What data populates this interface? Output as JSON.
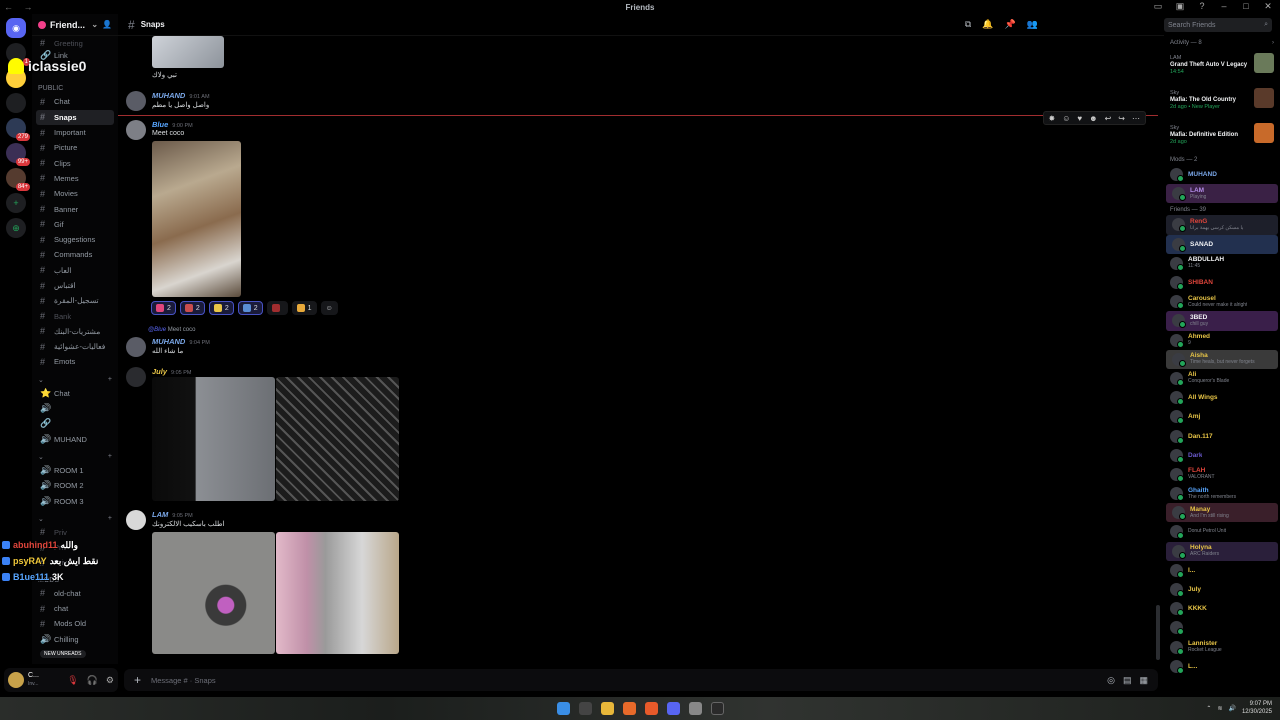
{
  "window": {
    "title": "Friends",
    "controls": [
      "pin",
      "minimize",
      "help",
      "minimize",
      "maximize",
      "close"
    ]
  },
  "rail": {
    "badges": [
      "1",
      "279",
      "99+",
      "84+"
    ]
  },
  "server": {
    "name": "Friend...",
    "overlay_username": "iclassie0"
  },
  "sidebar": {
    "top_items": [
      "Greeting",
      "Link"
    ],
    "public_label": "PUBLIC",
    "channels": [
      {
        "name": "Chat",
        "state": "normal"
      },
      {
        "name": "Snaps",
        "state": "active"
      },
      {
        "name": "Important",
        "state": "normal"
      },
      {
        "name": "Picture",
        "state": "normal"
      },
      {
        "name": "Clips",
        "state": "normal"
      },
      {
        "name": "Memes",
        "state": "normal"
      },
      {
        "name": "Movies",
        "state": "normal"
      },
      {
        "name": "Banner",
        "state": "normal"
      },
      {
        "name": "Gif",
        "state": "normal"
      },
      {
        "name": "Suggestions",
        "state": "normal"
      },
      {
        "name": "Commands",
        "state": "normal"
      },
      {
        "name": "العاب",
        "state": "normal"
      },
      {
        "name": "اقتباس",
        "state": "normal"
      },
      {
        "name": "تسجيل-المقرة",
        "state": "normal"
      },
      {
        "name": "Bank",
        "state": "muted"
      },
      {
        "name": "مشتريات-البنك",
        "state": "normal"
      },
      {
        "name": "فعاليات-عشوائية",
        "state": "normal"
      },
      {
        "name": "Emots",
        "state": "normal"
      }
    ],
    "voice_category": [
      {
        "name": "Chat",
        "icon": "star"
      },
      {
        "name": "",
        "icon": "speaker"
      },
      {
        "name": "",
        "icon": "link"
      },
      {
        "name": "MUHAND",
        "icon": "speaker"
      }
    ],
    "rooms": [
      "ROOM 1",
      "ROOM 2",
      "ROOM 3"
    ],
    "private": [
      "Priv",
      "Priv",
      "Priv"
    ],
    "mods_label": "Mods",
    "mods_channels": [
      "old-chat",
      "chat",
      "Mods Old",
      "Chilling"
    ],
    "new_unreads": "NEW UNREADS"
  },
  "chat_overlay": [
    {
      "user": "abuhind11",
      "text": "والله",
      "color": "#e0453b"
    },
    {
      "user": "psyRAY",
      "text": "نقط ايش بعد",
      "color": "#f0c83a"
    },
    {
      "user": "B1ue111",
      "text": "3K",
      "color": "#58a6ff"
    }
  ],
  "user_panel": {
    "name": "C...",
    "status": "Inv..."
  },
  "channel_header": {
    "name": "Snaps",
    "search_placeholder": "Search Friends"
  },
  "messages": [
    {
      "author": "",
      "time": "",
      "text": "تبي ولاك",
      "color": "#dbdee1"
    },
    {
      "author": "MUHAND",
      "time": "9:01 AM",
      "text": "واصل واصل يا مطم",
      "color": "#7aa7e8"
    },
    {
      "author": "Blue",
      "time": "9:00 PM",
      "text": "Meet coco",
      "color": "#58a6ff"
    },
    {
      "author": "MUHAND",
      "time": "9:04 PM",
      "text": "ما شاء الله",
      "color": "#7aa7e8",
      "reply_to": "@Blue",
      "reply_text": "Meet coco"
    },
    {
      "author": "July",
      "time": "9:05 PM",
      "text": "",
      "color": "#e8c547"
    },
    {
      "author": "LAM",
      "time": "9:05 PM",
      "text": "اطلب باسكيب الالكترونك",
      "color": "#7aa7e8"
    }
  ],
  "reactions": [
    {
      "emoji": "heart",
      "count": "2",
      "color": "#e0467c"
    },
    {
      "emoji": "flag",
      "count": "2",
      "color": "#c94d4d"
    },
    {
      "emoji": "sparkle",
      "count": "2",
      "color": "#e8c547"
    },
    {
      "emoji": "star",
      "count": "2",
      "color": "#5a8ed6"
    },
    {
      "emoji": "dot",
      "count": "",
      "color": "#a12d2f"
    },
    {
      "emoji": "crown",
      "count": "1",
      "color": "#e8a93a"
    },
    {
      "emoji": "add",
      "count": "",
      "color": "#555"
    }
  ],
  "composer": {
    "placeholder": "Message # · Snaps"
  },
  "members": {
    "activity_label": "Activity — 8",
    "activities": [
      {
        "user": "LAM",
        "game": "Grand Theft Auto V Legacy",
        "detail": "14:54",
        "thumb": "#6a7a5a"
      },
      {
        "user": "Sky",
        "game": "Mafia: The Old Country",
        "detail": "2d ago • New Player",
        "thumb": "#5a3a2a"
      },
      {
        "user": "Sky",
        "game": "Mafia: Definitive Edition",
        "detail": "2d ago",
        "thumb": "#c86a2a"
      }
    ],
    "mods_label": "Mods — 2",
    "mods": [
      {
        "name": "MUHAND",
        "sub": "",
        "color": "#7aa7e8",
        "banner": ""
      },
      {
        "name": "LAM",
        "sub": "Playing",
        "color": "#b38de8",
        "banner": "#3a2145"
      }
    ],
    "friends_label": "Friends — 39",
    "friends": [
      {
        "name": "RenG",
        "sub": "يا مسكن كرسي بهمة برانا",
        "color": "#e0453b",
        "banner": "#1d1f2a"
      },
      {
        "name": "SANAD",
        "sub": "",
        "color": "#f2f3f5",
        "banner": "#22304f"
      },
      {
        "name": "ABDULLAH",
        "sub": "11:45",
        "color": "#f2f3f5",
        "banner": ""
      },
      {
        "name": "SHIBAN",
        "sub": "",
        "color": "#e0453b",
        "banner": ""
      },
      {
        "name": "Carousel",
        "sub": "Could never make it alright",
        "color": "#e8c547",
        "banner": ""
      },
      {
        "name": "3BED",
        "sub": "chill guy",
        "color": "#f2f3f5",
        "banner": "#3a1f4a"
      },
      {
        "name": "Ahmed",
        "sub": "9",
        "color": "#e8c547",
        "banner": ""
      },
      {
        "name": "Aisha",
        "sub": "Time heals, but never forgets",
        "color": "#e8c547",
        "banner": "#3a3a3a"
      },
      {
        "name": "Ali",
        "sub": "Conqueror's Blade",
        "color": "#e8c547",
        "banner": ""
      },
      {
        "name": "All Wings",
        "sub": "",
        "color": "#e8c547",
        "banner": ""
      },
      {
        "name": "Amj",
        "sub": "",
        "color": "#e8c547",
        "banner": ""
      },
      {
        "name": "Dan.117",
        "sub": "",
        "color": "#e8c547",
        "banner": ""
      },
      {
        "name": "Dark",
        "sub": "",
        "color": "#6a5acd",
        "banner": ""
      },
      {
        "name": "FLAH",
        "sub": "VALORANT",
        "color": "#e0453b",
        "banner": ""
      },
      {
        "name": "Ghaith",
        "sub": "The north remembers",
        "color": "#58a6ff",
        "banner": ""
      },
      {
        "name": "Manay",
        "sub": "And I'm still rising",
        "color": "#e8c547",
        "banner": "#3a1f2a"
      },
      {
        "name": "",
        "sub": "Donut Petrol Unit",
        "color": "#e8c547",
        "banner": ""
      },
      {
        "name": "Holyna",
        "sub": "ARC Raiders",
        "color": "#e8c547",
        "banner": "#2a1f3a"
      },
      {
        "name": "I...",
        "sub": "",
        "color": "#e8c547",
        "banner": ""
      },
      {
        "name": "July",
        "sub": "",
        "color": "#e8c547",
        "banner": ""
      },
      {
        "name": "KKKK",
        "sub": "",
        "color": "#e8c547",
        "banner": ""
      },
      {
        "name": "",
        "sub": "",
        "color": "#e8c547",
        "banner": ""
      },
      {
        "name": "Lannister",
        "sub": "Rocket League",
        "color": "#e8c547",
        "banner": ""
      },
      {
        "name": "L...",
        "sub": "",
        "color": "#e8c547",
        "banner": ""
      }
    ]
  },
  "taskbar": {
    "time": "9:07 PM",
    "date": "12/30/2025"
  }
}
